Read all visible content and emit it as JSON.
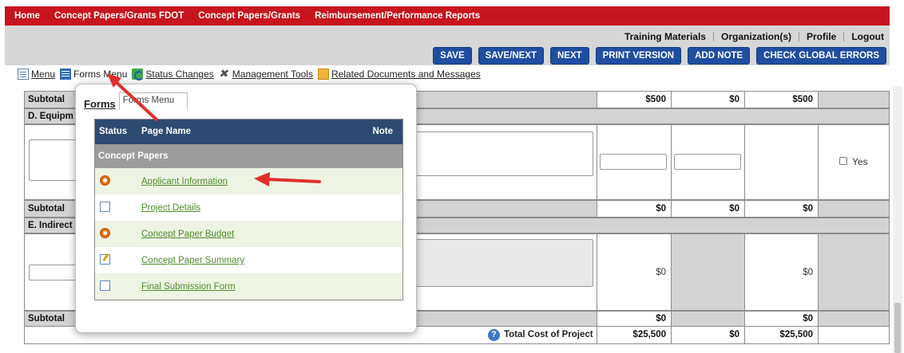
{
  "nav": {
    "items": [
      "Home",
      "Concept Papers/Grants FDOT",
      "Concept Papers/Grants",
      "Reimbursement/Performance Reports"
    ]
  },
  "user_links": [
    "Training Materials",
    "Organization(s)",
    "Profile",
    "Logout"
  ],
  "actions": [
    "SAVE",
    "SAVE/NEXT",
    "NEXT",
    "PRINT VERSION",
    "ADD NOTE",
    "CHECK GLOBAL ERRORS"
  ],
  "toolbar": {
    "menu": "Menu",
    "forms_menu": "Forms Menu",
    "status_changes": "Status Changes",
    "management_tools": "Management Tools",
    "related_docs": "Related Documents and Messages"
  },
  "table": {
    "subtotal_label": "Subtotal",
    "section_d": "D. Equipm",
    "section_e": "E. Indirect",
    "row1": {
      "c1": "$500",
      "c2": "$0",
      "c3": "$500"
    },
    "row3": {
      "c1": "$0",
      "c2": "$0",
      "c3": "$0"
    },
    "row5": {
      "c1": "$0",
      "c3": "$0"
    },
    "row6": {
      "c1": "$0",
      "c3": "$0"
    },
    "yes_label": "Yes",
    "total_label": "Total Cost of Project",
    "total": {
      "c1": "$25,500",
      "c2": "$0",
      "c3": "$25,500"
    }
  },
  "popup": {
    "tab_active": "Forms",
    "tab_other": "Forms Menu",
    "headers": {
      "status": "Status",
      "page": "Page Name",
      "note": "Note"
    },
    "group": "Concept Papers",
    "rows": [
      {
        "name": "Applicant Information",
        "icon": "in-progress-icon"
      },
      {
        "name": "Project Details",
        "icon": "document-icon"
      },
      {
        "name": "Concept Paper Budget",
        "icon": "in-progress-icon"
      },
      {
        "name": "Concept Paper Summary",
        "icon": "edit-icon"
      },
      {
        "name": "Final Submission Form",
        "icon": "document-icon"
      }
    ]
  },
  "colors": {
    "nav_red": "#c8151d",
    "button_blue": "#1f4ea1",
    "header_navy": "#2d4a72",
    "link_green": "#4e8c2a",
    "arrow_red": "#e0302b"
  }
}
